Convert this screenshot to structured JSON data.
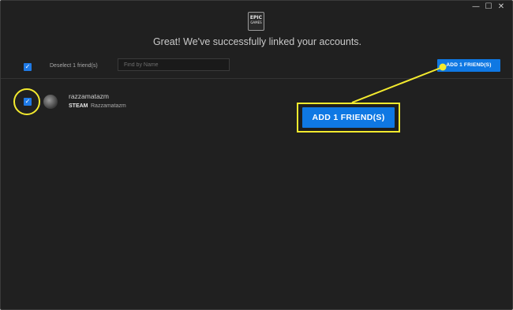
{
  "window": {
    "controls": {
      "minimize": "—",
      "maximize": "☐",
      "close": "✕"
    }
  },
  "logo": {
    "line1": "EPIC",
    "line2": "GAMES"
  },
  "header": {
    "headline": "Great! We've successfully linked your accounts."
  },
  "toolbar": {
    "select_all_checked": true,
    "deselect_label": "Deselect 1 friend(s)",
    "search_placeholder": "Find by Name",
    "add_button_label": "ADD 1 FRIEND(S)"
  },
  "friends": [
    {
      "name": "razzamatazm",
      "platform": "STEAM",
      "account": "Razzamatazm",
      "checked": true
    }
  ],
  "callout": {
    "button_label": "ADD 1 FRIEND(S)"
  },
  "colors": {
    "accent_blue": "#0f78e3",
    "annotation_yellow": "#f3ea2e",
    "background": "#202020"
  }
}
